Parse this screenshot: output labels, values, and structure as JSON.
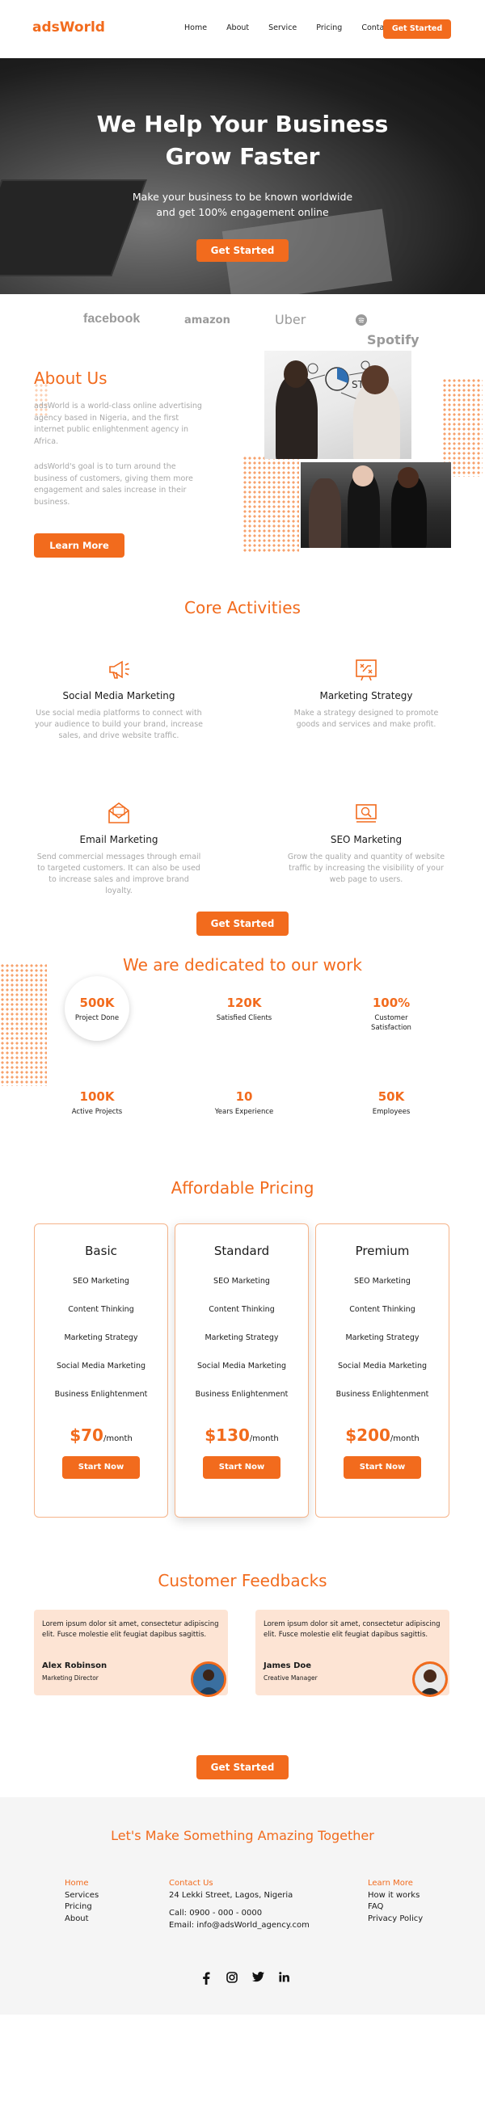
{
  "brand": "adsWorld",
  "nav": {
    "links": [
      "Home",
      "About",
      "Service",
      "Pricing",
      "Contact"
    ],
    "cta": "Get Started"
  },
  "hero": {
    "title_line1": "We Help Your Business",
    "title_line2": "Grow Faster",
    "subtitle_line1": "Make your business to be known worldwide",
    "subtitle_line2": "and get 100% engagement online",
    "cta": "Get Started"
  },
  "brands": [
    "facebook",
    "amazon",
    "Uber",
    "Spotify"
  ],
  "about": {
    "title": "About Us",
    "para1": "adsWorld is a world-class online advertising agency based in Nigeria, and the first internet public enlightenment agency in Africa.",
    "para2": "adsWorld's goal is to turn around the business of customers, giving them more engagement and sales increase in their business.",
    "cta": "Learn More"
  },
  "core": {
    "title": "Core Activities",
    "activities": [
      {
        "icon": "megaphone-icon",
        "title": "Social Media Marketing",
        "desc": "Use social media platforms to connect with your audience to build your brand, increase sales, and drive website traffic."
      },
      {
        "icon": "strategy-icon",
        "title": "Marketing Strategy",
        "desc": "Make a strategy designed to promote goods and services and make profit."
      },
      {
        "icon": "envelope-icon",
        "title": "Email Marketing",
        "desc": "Send commercial messages through email to targeted customers. It can also be used to increase sales and improve brand loyalty."
      },
      {
        "icon": "seo-icon",
        "title": "SEO Marketing",
        "desc": "Grow the quality and quantity of website traffic by increasing the visibility of your web page to users."
      }
    ],
    "cta": "Get Started"
  },
  "dedicated": {
    "title": "We are dedicated to our work",
    "stats": [
      {
        "value": "500K",
        "label": "Project Done"
      },
      {
        "value": "120K",
        "label": "Satisfied Clients"
      },
      {
        "value": "100%",
        "label": "Customer Satisfaction"
      },
      {
        "value": "100K",
        "label": "Active Projects"
      },
      {
        "value": "10",
        "label": "Years Experience"
      },
      {
        "value": "50K",
        "label": "Employees"
      }
    ]
  },
  "pricing": {
    "title": "Affordable Pricing",
    "plans": [
      {
        "name": "Basic",
        "features": [
          "SEO Marketing",
          "Content Thinking",
          "Marketing Strategy",
          "Social Media Marketing",
          "Business Enlightenment"
        ],
        "price": "$70",
        "period": "/month",
        "cta": "Start Now"
      },
      {
        "name": "Standard",
        "features": [
          "SEO Marketing",
          "Content Thinking",
          "Marketing Strategy",
          "Social Media Marketing",
          "Business Enlightenment"
        ],
        "price": "$130",
        "period": "/month",
        "cta": "Start Now"
      },
      {
        "name": "Premium",
        "features": [
          "SEO Marketing",
          "Content Thinking",
          "Marketing Strategy",
          "Social Media Marketing",
          "Business Enlightenment"
        ],
        "price": "$200",
        "period": "/month",
        "cta": "Start Now"
      }
    ]
  },
  "feedback": {
    "title": "Customer Feedbacks",
    "items": [
      {
        "text": "Lorem ipsum dolor sit amet, consectetur adipiscing elit. Fusce molestie elit feugiat dapibus sagittis.",
        "name": "Alex Robinson",
        "role": "Marketing Director"
      },
      {
        "text": "Lorem ipsum dolor sit amet, consectetur adipiscing elit. Fusce molestie elit feugiat dapibus sagittis.",
        "name": "James Doe",
        "role": "Creative Manager"
      }
    ],
    "cta": "Get Started"
  },
  "footer": {
    "title": "Let's Make Something Amazing Together",
    "col1": {
      "head": "Home",
      "items": [
        "Services",
        "Pricing",
        "About"
      ]
    },
    "col2": {
      "head": "Contact Us",
      "address": "24 Lekki Street, Lagos, Nigeria",
      "phone": "Call: 0900 - 000 - 0000",
      "email": "Email: info@adsWorld_agency.com"
    },
    "col3": {
      "head": "Learn More",
      "items": [
        "How it works",
        "FAQ",
        "Privacy Policy"
      ]
    },
    "socials": [
      "facebook-icon",
      "instagram-icon",
      "twitter-icon",
      "linkedin-icon"
    ]
  },
  "colors": {
    "accent": "#f26b1d",
    "muted": "#a8a8a8",
    "feedback_bg": "#fde4d4",
    "footer_bg": "#f5f5f5"
  }
}
